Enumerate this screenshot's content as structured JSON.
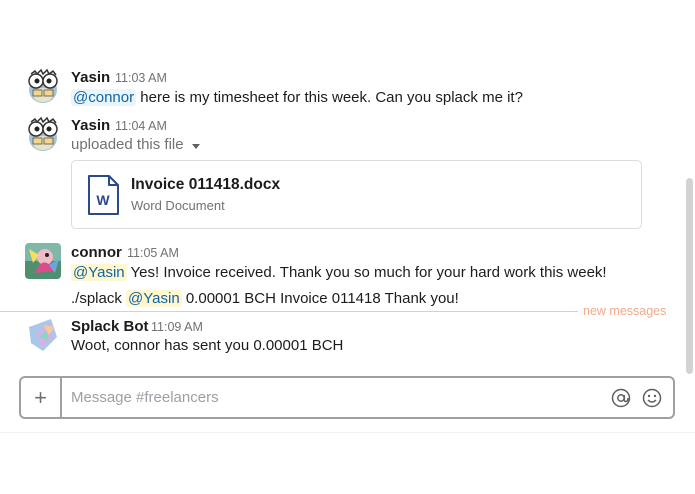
{
  "messages": [
    {
      "author": "Yasin",
      "time": "11:03 AM",
      "mention": "@connor",
      "text": " here is my timesheet for this week. Can you splack me it?"
    },
    {
      "author": "Yasin",
      "time": "11:04 AM",
      "action": "uploaded this file",
      "file": {
        "name": "Invoice 011418.docx",
        "type": "Word Document",
        "icon_letter": "W"
      }
    },
    {
      "author": "connor",
      "time": "11:05 AM",
      "line1_mention": "@Yasin",
      "line1_text": " Yes! Invoice received. Thank you so much for your hard work this week!",
      "line2_prefix": "./splack ",
      "line2_mention": "@Yasin",
      "line2_text": " 0.00001 BCH Invoice 011418 Thank you!"
    },
    {
      "author": "Splack Bot",
      "time": "11:09 AM",
      "text": "Woot, connor has sent you 0.00001 BCH"
    }
  ],
  "divider_label": "new messages",
  "composer": {
    "plus_label": "+",
    "placeholder": "Message #freelancers"
  },
  "icons": [
    "plus-icon",
    "at-sign-icon",
    "emoji-icon",
    "caret-down-icon",
    "word-file-icon"
  ],
  "colors": {
    "mention_bg": "#e8f5fa",
    "mention_text": "#1264a3",
    "mention_highlight_bg": "#fff7cf",
    "new_messages": "#f2a98a",
    "file_icon": "#2a4a8c"
  }
}
